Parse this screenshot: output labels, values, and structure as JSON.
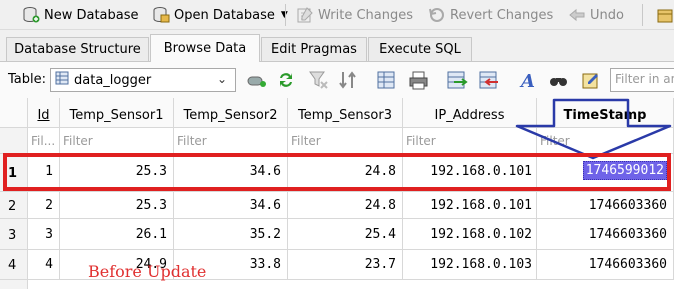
{
  "toolbar": {
    "new_database": "New Database",
    "open_database": "Open Database",
    "write_changes": "Write Changes",
    "revert_changes": "Revert Changes",
    "undo": "Undo",
    "icons": [
      "new-database-icon",
      "open-database-icon",
      "write-changes-icon",
      "revert-changes-icon",
      "undo-icon"
    ]
  },
  "tabs": [
    "Database Structure",
    "Browse Data",
    "Edit Pragmas",
    "Execute SQL"
  ],
  "active_tab": "Browse Data",
  "table_toolbar": {
    "label": "Table:",
    "selected_table": "data_logger",
    "filter_placeholder": "Filter in an"
  },
  "grid": {
    "columns": [
      "Id",
      "Temp_Sensor1",
      "Temp_Sensor2",
      "Temp_Sensor3",
      "IP_Address",
      "TimeStamp"
    ],
    "filters": [
      "Fil...",
      "Filter",
      "Filter",
      "Filter",
      "Filter",
      "Filter"
    ],
    "rows": [
      {
        "num": "1",
        "values": [
          "1",
          "25.3",
          "34.6",
          "24.8",
          "192.168.0.101",
          "1746599012"
        ]
      },
      {
        "num": "2",
        "values": [
          "2",
          "25.3",
          "34.6",
          "24.8",
          "192.168.0.101",
          "1746603360"
        ]
      },
      {
        "num": "3",
        "values": [
          "3",
          "26.1",
          "35.2",
          "25.4",
          "192.168.0.102",
          "1746603360"
        ]
      },
      {
        "num": "4",
        "values": [
          "4",
          "24.9",
          "33.8",
          "23.7",
          "192.168.0.103",
          "1746603360"
        ]
      }
    ]
  },
  "annotation": {
    "note": "Before  Update",
    "highlight_color": "#e02020",
    "arrow_color": "#2a3aa8"
  }
}
